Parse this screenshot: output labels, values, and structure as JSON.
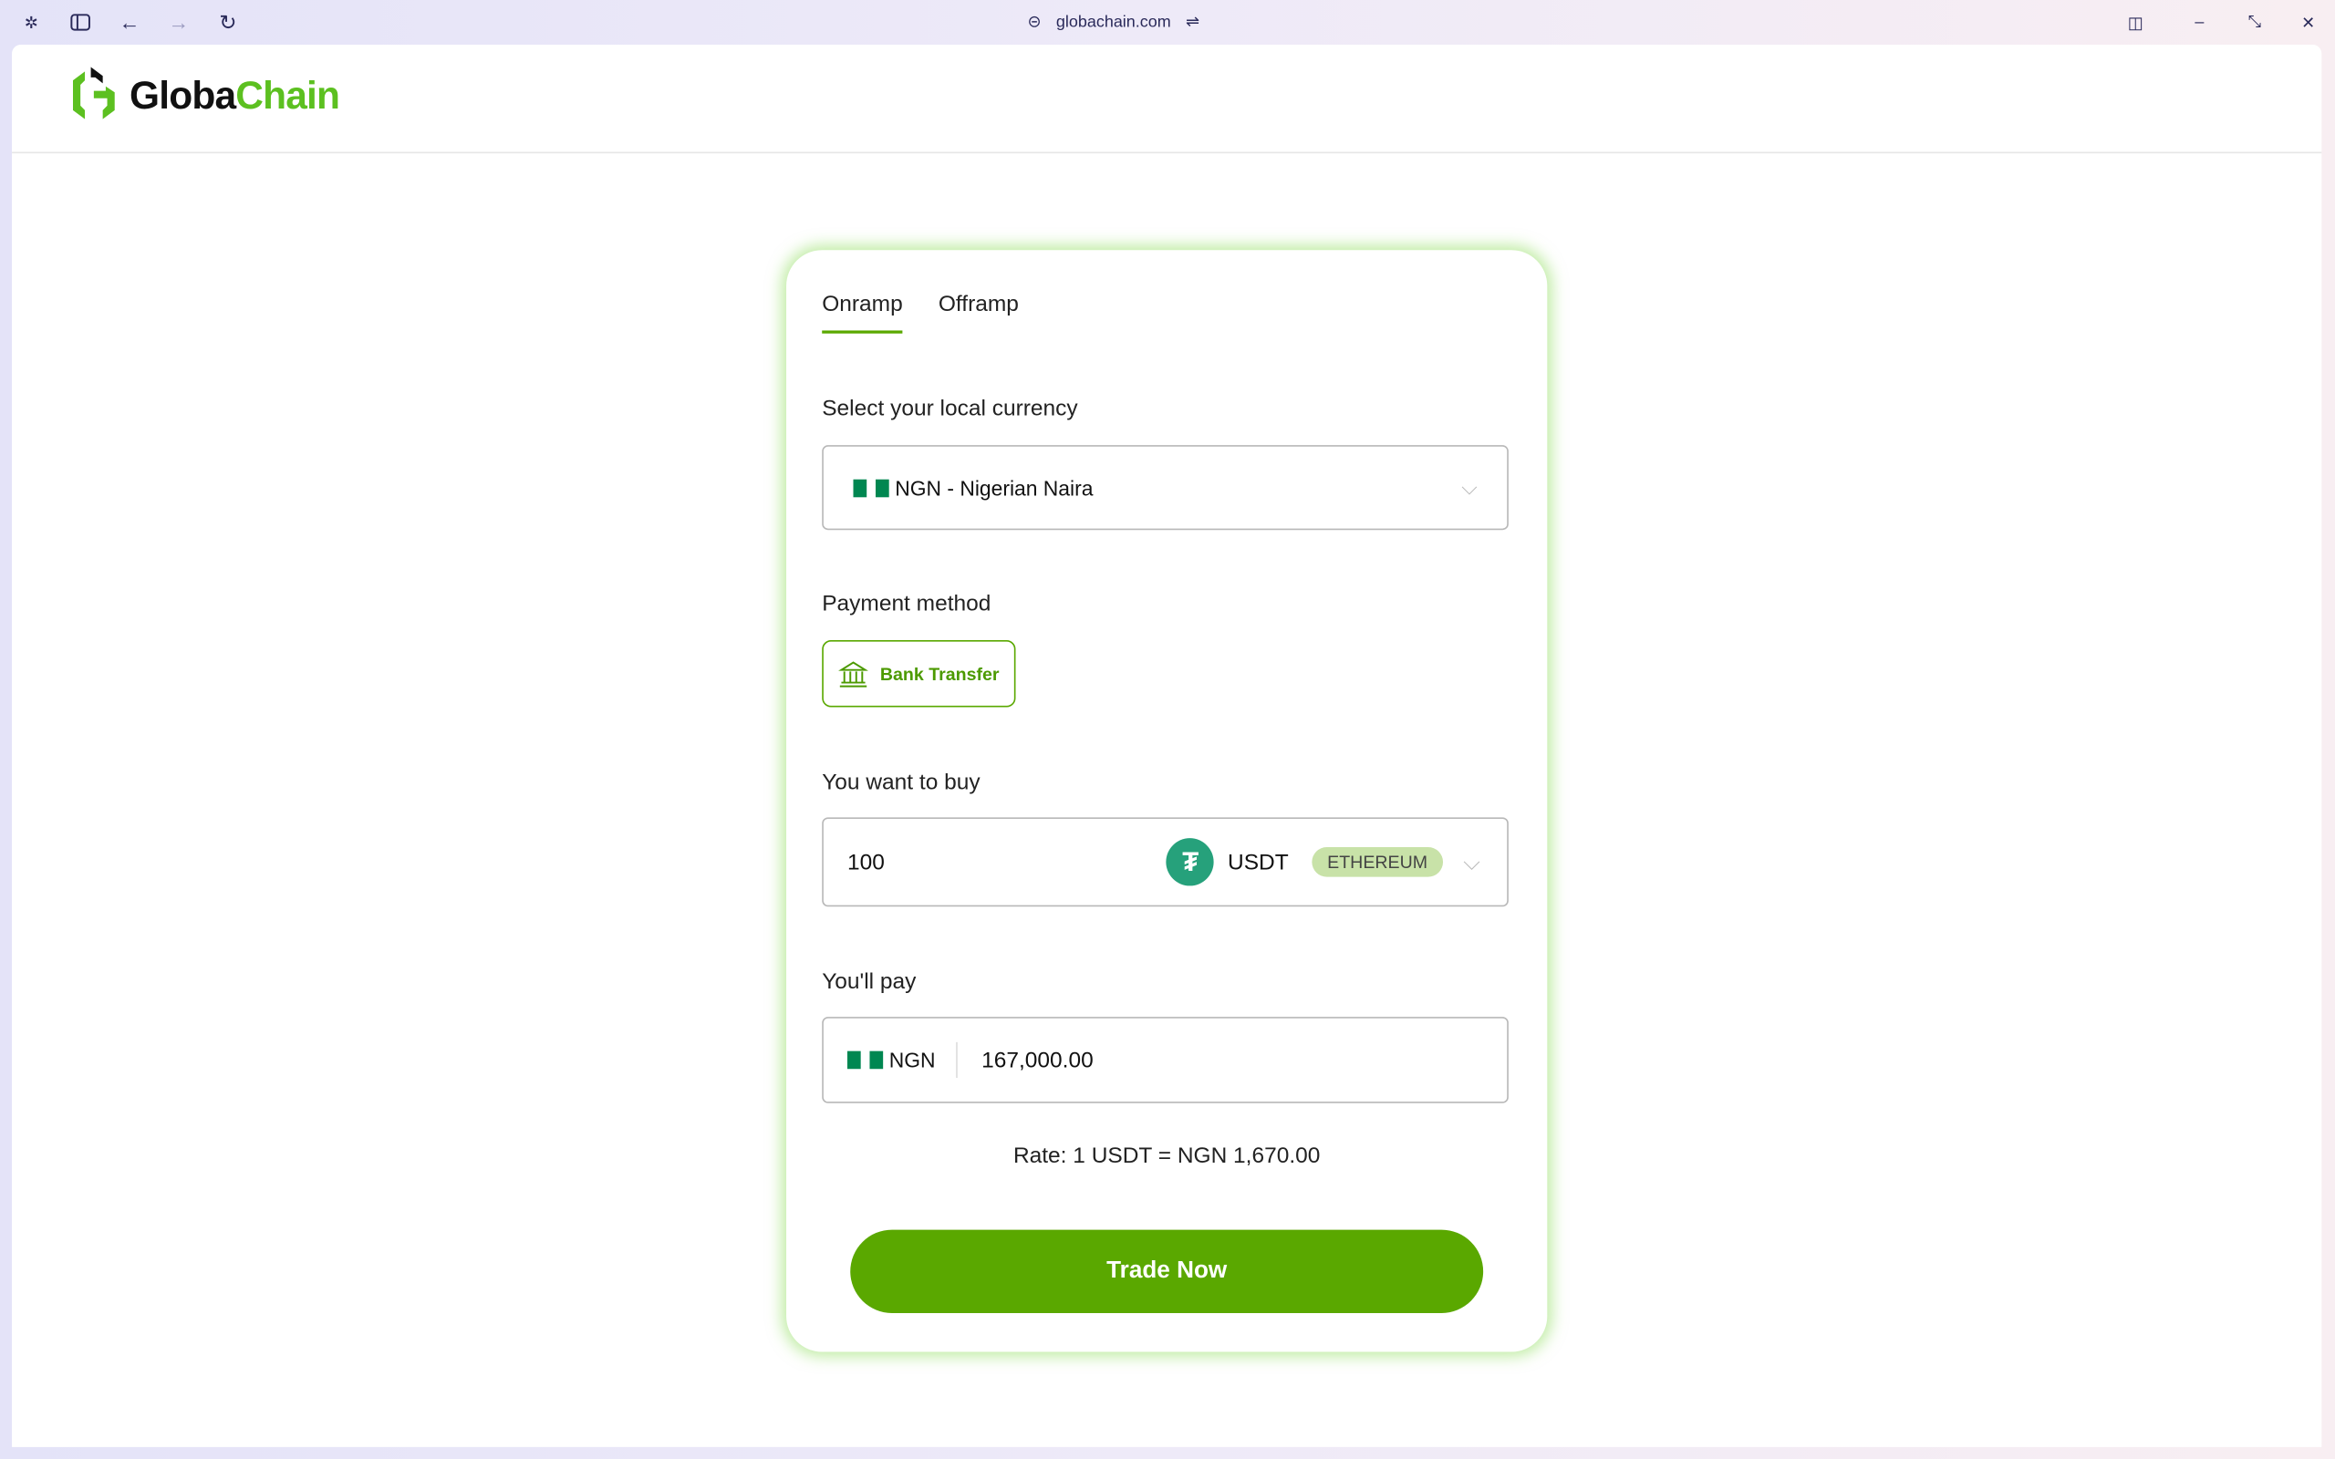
{
  "browser": {
    "url": "globachain.com"
  },
  "logo": {
    "part1": "Globa",
    "part2": "Chain"
  },
  "tabs": [
    {
      "label": "Onramp",
      "active": true
    },
    {
      "label": "Offramp",
      "active": false
    }
  ],
  "currency": {
    "label": "Select your local currency",
    "value": "NGN - Nigerian Naira"
  },
  "payment": {
    "label": "Payment method",
    "method": "Bank Transfer"
  },
  "buy": {
    "label": "You want to buy",
    "amount": "100",
    "token": "USDT",
    "network": "ETHEREUM"
  },
  "pay": {
    "label": "You'll pay",
    "currency": "NGN",
    "amount": "167,000.00"
  },
  "rate": "Rate: 1 USDT = NGN 1,670.00",
  "cta": "Trade Now",
  "colors": {
    "brand": "#5aa800",
    "tether": "#26a17b",
    "flag": "#008751"
  }
}
